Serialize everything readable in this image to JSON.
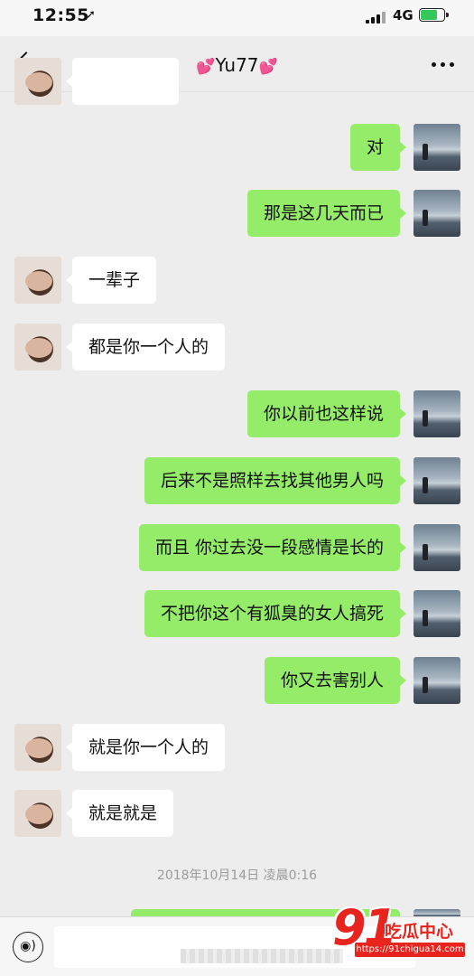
{
  "status_bar": {
    "time": "12:55",
    "location_icon": "navigation-arrow-icon",
    "network": "4G",
    "battery_icon": "battery-charging-icon"
  },
  "nav": {
    "back_icon": "chevron-left-icon",
    "title_heart": "💕",
    "title_name": "Yu77",
    "more_icon": "more-dots-icon"
  },
  "messages": [
    {
      "side": "right",
      "text": "对"
    },
    {
      "side": "right",
      "text": "那是这几天而已"
    },
    {
      "side": "left",
      "text": "一辈子"
    },
    {
      "side": "left",
      "text": "都是你一个人的"
    },
    {
      "side": "right",
      "text": "你以前也这样说"
    },
    {
      "side": "right",
      "text": "后来不是照样去找其他男人吗"
    },
    {
      "side": "right",
      "text": "而且 你过去没一段感情是长的"
    },
    {
      "side": "right",
      "text": "不把你这个有狐臭的女人搞死"
    },
    {
      "side": "right",
      "text": "你又去害别人"
    },
    {
      "side": "left",
      "text": "就是你一个人的"
    },
    {
      "side": "left",
      "text": "就是就是"
    }
  ],
  "timestamp": "2018年10月14日 凌晨0:16",
  "input_bar": {
    "voice_icon": "voice-icon",
    "value": ""
  },
  "watermark": {
    "number": "91",
    "text": "吃瓜中心",
    "url": "https://91chigua14.com"
  },
  "colors": {
    "background": "#ededed",
    "bubble_sent": "#95ec69",
    "bubble_received": "#ffffff",
    "watermark_red": "#e8241e"
  }
}
